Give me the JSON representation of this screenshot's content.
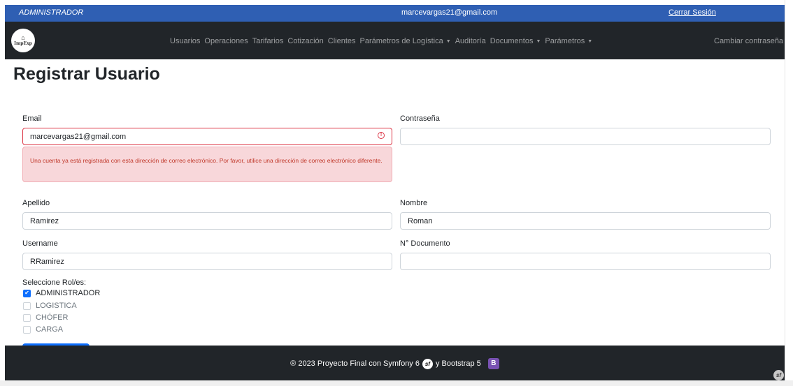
{
  "topbar": {
    "role": "ADMINISTRADOR",
    "email": "marcevargas21@gmail.com",
    "logout": "Cerrar Sesión"
  },
  "brand": {
    "logo_mark": "⌂",
    "logo_text": "ImpExp"
  },
  "nav": {
    "items": [
      {
        "label": "Usuarios",
        "dropdown": false
      },
      {
        "label": "Operaciones",
        "dropdown": false
      },
      {
        "label": "Tarifarios",
        "dropdown": false
      },
      {
        "label": "Cotización",
        "dropdown": false
      },
      {
        "label": "Clientes",
        "dropdown": false
      },
      {
        "label": "Parámetros de Logística",
        "dropdown": true
      },
      {
        "label": "Auditoría",
        "dropdown": false
      },
      {
        "label": "Documentos",
        "dropdown": true
      },
      {
        "label": "Parámetros",
        "dropdown": true
      }
    ],
    "caret": "▼",
    "right": "Cambiar contraseña"
  },
  "page": {
    "title": "Registrar Usuario"
  },
  "form": {
    "email_label": "Email",
    "email_value": "marcevargas21@gmail.com",
    "email_error_icon": "!",
    "email_error": "Una cuenta ya está registrada con esta dirección de correo electrónico. Por favor, utilice una dirección de correo electrónico diferente.",
    "password_label": "Contraseña",
    "password_value": "",
    "apellido_label": "Apellido",
    "apellido_value": "Ramirez",
    "nombre_label": "Nombre",
    "nombre_value": "Roman",
    "username_label": "Username",
    "username_value": "RRamirez",
    "documento_label": "N° Documento",
    "documento_value": "",
    "roles_label": "Seleccione Rol/es:",
    "roles": [
      {
        "label": "ADMINISTRADOR",
        "checked": true
      },
      {
        "label": "LOGISTICA",
        "checked": false
      },
      {
        "label": "CHÓFER",
        "checked": false
      },
      {
        "label": "CARGA",
        "checked": false
      }
    ],
    "check_mark": "✔"
  },
  "footer": {
    "text_before": "® 2023 Proyecto Final con Symfony 6",
    "sf_badge": "sf",
    "text_middle": "y Bootstrap 5",
    "bs_badge": "B"
  },
  "colors": {
    "topbar": "#2f5fb3",
    "navbar": "#212529",
    "accent": "#0d6efd",
    "error": "#dc3545",
    "error_bg": "#f8d7da"
  }
}
